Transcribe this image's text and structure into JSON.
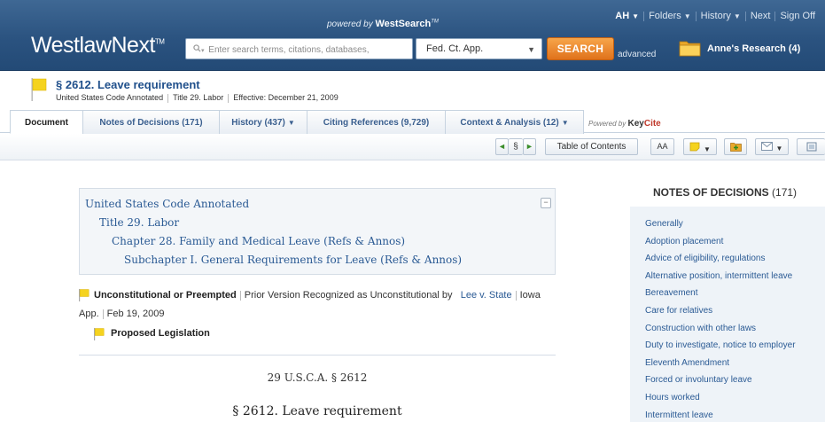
{
  "topnav": {
    "user": "AH",
    "items": [
      "Folders",
      "History",
      "Next",
      "Sign Off"
    ]
  },
  "header": {
    "powered_prefix": "powered by",
    "powered_brand": "WestSearch",
    "powered_tm": "TM",
    "logo": "WestlawNext",
    "logo_tm": "TM",
    "search_placeholder": "Enter search terms, citations, databases,",
    "jurisdiction": "Fed. Ct. App.",
    "search_button": "SEARCH",
    "advanced": "advanced",
    "folder": "Anne's Research (4)"
  },
  "document": {
    "title": "§ 2612. Leave requirement",
    "meta": [
      "United States Code Annotated",
      "Title 29. Labor",
      "Effective: December 21, 2009"
    ]
  },
  "tabs": [
    {
      "label": "Document",
      "caret": false
    },
    {
      "label": "Notes of Decisions (171)",
      "caret": false
    },
    {
      "label": "History (437)",
      "caret": true
    },
    {
      "label": "Citing References (9,729)",
      "caret": false
    },
    {
      "label": "Context & Analysis (12)",
      "caret": true
    }
  ],
  "keycite": {
    "prefix": "Powered by",
    "brand_a": "Key",
    "brand_b": "Cite"
  },
  "toolbar": {
    "prev": "◄",
    "section": "§",
    "next": "►",
    "toc": "Table of Contents",
    "font": "AA"
  },
  "toc": [
    "United States Code Annotated",
    "Title 29. Labor",
    "Chapter 28. Family and Medical Leave (Refs & Annos)",
    "Subchapter I. General Requirements for Leave (Refs & Annos)"
  ],
  "status": {
    "label": "Unconstitutional or Preempted",
    "text": "Prior Version Recognized as Unconstitutional by",
    "case": "Lee v. State",
    "court": "Iowa App.",
    "date": "Feb 19, 2009",
    "proposed": "Proposed Legislation"
  },
  "body": {
    "citation": "29 U.S.C.A. § 2612",
    "heading": "§ 2612. Leave requirement"
  },
  "notes": {
    "heading": "NOTES OF DECISIONS",
    "count": "(171)",
    "items": [
      "Generally",
      "Adoption placement",
      "Advice of eligibility, regulations",
      "Alternative position, intermittent leave",
      "Bereavement",
      "Care for relatives",
      "Construction with other laws",
      "Duty to investigate, notice to employer",
      "Eleventh Amendment",
      "Forced or involuntary leave",
      "Hours worked",
      "Intermittent leave"
    ]
  },
  "colors": {
    "header_blue": "#2b5380",
    "link_blue": "#2a5a94",
    "search_orange": "#e0721b",
    "flag_yellow": "#f5d31f"
  }
}
